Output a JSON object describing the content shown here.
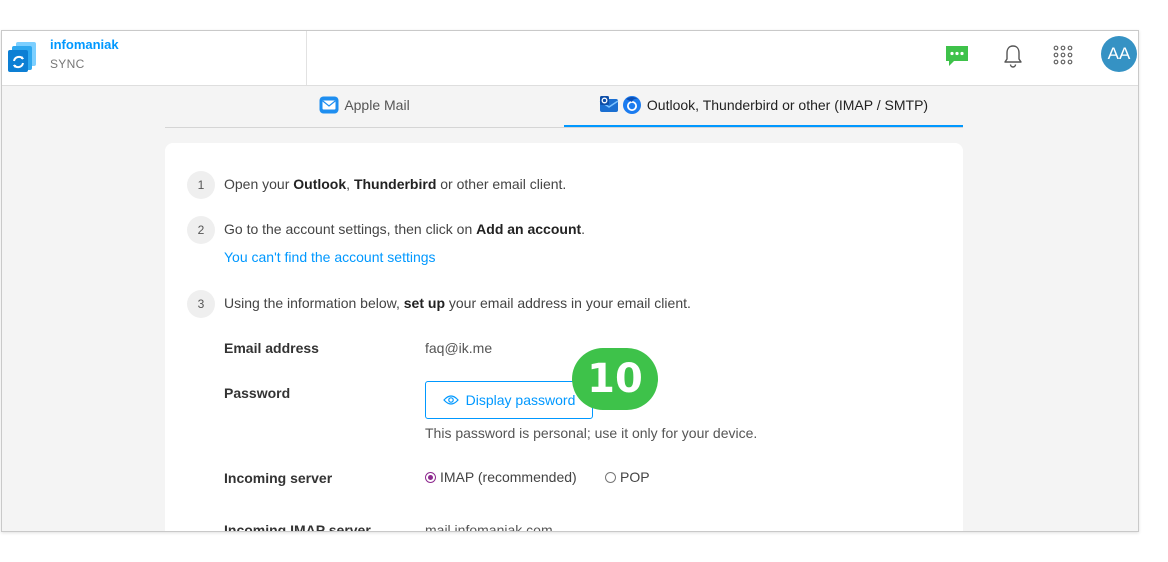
{
  "brand": {
    "name": "infomaniak",
    "product": "SYNC"
  },
  "header": {
    "avatar_initials": "AA",
    "accent_color": "#0098ff",
    "avatar_color": "#3592c4"
  },
  "tabs": [
    {
      "label": "Apple Mail",
      "icon": "apple-mail-icon",
      "active": false
    },
    {
      "label": "Outlook, Thunderbird or other (IMAP / SMTP)",
      "icon": "thunderbird-icon",
      "active": true
    }
  ],
  "steps": [
    {
      "number": "1",
      "t1": "Open your ",
      "b1": "Outlook",
      "t2": ", ",
      "b2": "Thunderbird",
      "t3": " or other email client."
    },
    {
      "number": "2",
      "t1": "Go to the account settings, then click on ",
      "b1": "Add an account",
      "t2": "."
    },
    {
      "number": "3",
      "t1": "Using the information below, ",
      "b1": "set up",
      "t2": " your email address in your email client."
    }
  ],
  "help_link": "You can't find the account settings",
  "fields": {
    "email_label": "Email address",
    "email_value": "faq@ik.me",
    "password_label": "Password",
    "password_button": "Display password",
    "password_note": "This password is personal; use it only for your device.",
    "incoming_label": "Incoming server",
    "incoming_options": [
      {
        "label": "IMAP (recommended)",
        "selected": true
      },
      {
        "label": "POP",
        "selected": false
      }
    ],
    "imap_label": "Incoming IMAP server",
    "imap_value": "mail.infomaniak.com"
  },
  "annotation": {
    "step_badge": "10",
    "color": "#3ec24a"
  }
}
